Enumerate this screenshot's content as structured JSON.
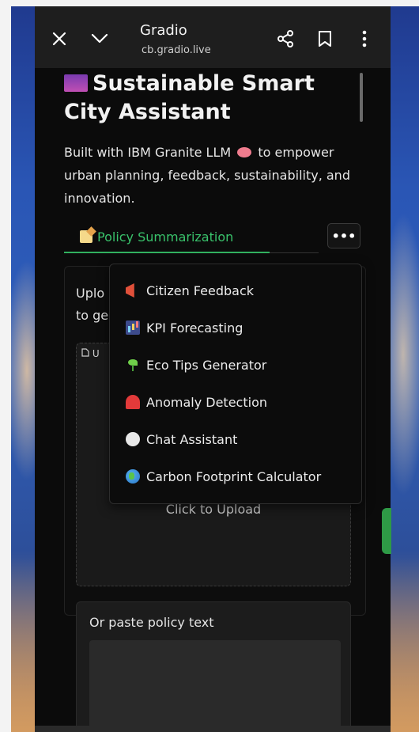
{
  "browser": {
    "title": "Gradio",
    "url": "cb.gradio.live",
    "close_icon": "close-icon",
    "collapse_icon": "chevron-down-icon",
    "share_icon": "share-icon",
    "bookmark_icon": "bookmark-icon",
    "menu_icon": "more-vert-icon"
  },
  "app": {
    "title": "Sustainable Smart City Assistant",
    "description_before": "Built with IBM Granite LLM",
    "description_after": "to empower urban planning, feedback, sustainability, and innovation.",
    "accent_color": "#39c26b"
  },
  "tabs": {
    "active_label": "Policy Summarization",
    "more_label": "•••",
    "overflow_items": [
      {
        "label": "Citizen Feedback",
        "icon": "megaphone-icon"
      },
      {
        "label": "KPI Forecasting",
        "icon": "bar-chart-icon"
      },
      {
        "label": "Eco Tips Generator",
        "icon": "seedling-icon"
      },
      {
        "label": "Anomaly Detection",
        "icon": "siren-icon"
      },
      {
        "label": "Chat Assistant",
        "icon": "speech-bubble-icon"
      },
      {
        "label": "Carbon Footprint Calculator",
        "icon": "globe-icon"
      }
    ]
  },
  "policy": {
    "intro_line1": "Uplo",
    "intro_line2": "to ge",
    "upload_tab": "U",
    "upload_label": "Click to Upload",
    "paste_label": "Or paste policy text"
  }
}
